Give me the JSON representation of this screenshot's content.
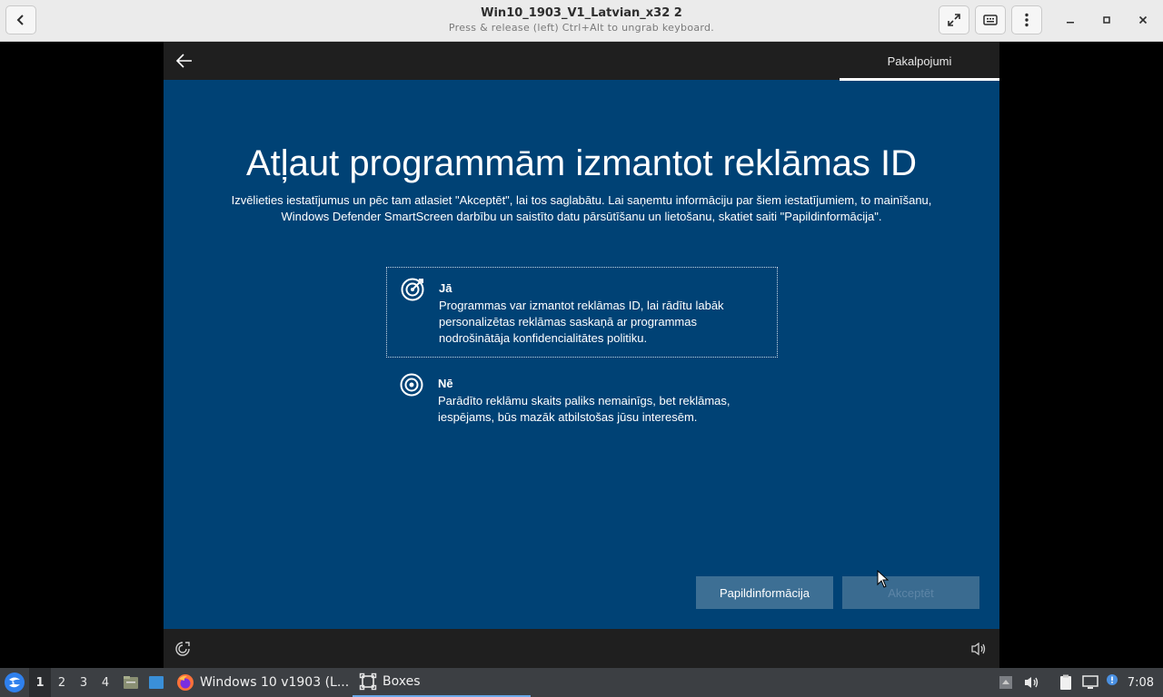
{
  "window": {
    "title": "Win10_1903_V1_Latvian_x32 2",
    "subtitle": "Press & release (left) Ctrl+Alt to ungrab keyboard."
  },
  "titlebar_icons": {
    "back": "chevron-left-icon",
    "fullscreen": "fullscreen-icon",
    "keyboard": "keyboard-icon",
    "menu": "kebab-menu-icon",
    "minimize": "minimize-icon",
    "maximize": "maximize-icon",
    "close": "close-icon"
  },
  "setup": {
    "tab_label": "Pakalpojumi",
    "heading": "Atļaut programmām izmantot reklāmas ID",
    "description": "Izvēlieties iestatījumus un pēc tam atlasiet \"Akceptēt\", lai tos saglabātu. Lai saņemtu informāciju par šiem iestatījumiem, to mainīšanu, Windows Defender SmartScreen darbību un saistīto datu pārsūtīšanu un lietošanu, skatiet saiti \"Papildinformācija\".",
    "options": [
      {
        "title": "Jā",
        "text": "Programmas var izmantot reklāmas ID, lai rādītu labāk personalizētas reklāmas saskaņā ar programmas nodrošinātāja konfidencialitātes politiku.",
        "selected": true
      },
      {
        "title": "Nē",
        "text": "Parādīto reklāmu skaits paliks nemainīgs, bet reklāmas, iespējams, būs mazāk atbilstošas jūsu interesēm.",
        "selected": false
      }
    ],
    "more_info_button": "Papildinformācija",
    "accept_button": "Akceptēt"
  },
  "colors": {
    "oobe_blue": "#004275",
    "vm_bar": "#1f1f1f",
    "taskbar": "#3c3f43"
  },
  "taskbar": {
    "workspaces": [
      "1",
      "2",
      "3",
      "4"
    ],
    "active_workspace": "1",
    "apps": [
      {
        "label": "Windows 10 v1903 (L...",
        "icon": "firefox-icon"
      },
      {
        "label": "Boxes",
        "icon": "boxes-icon",
        "active": true
      }
    ],
    "clock": "7:08"
  }
}
